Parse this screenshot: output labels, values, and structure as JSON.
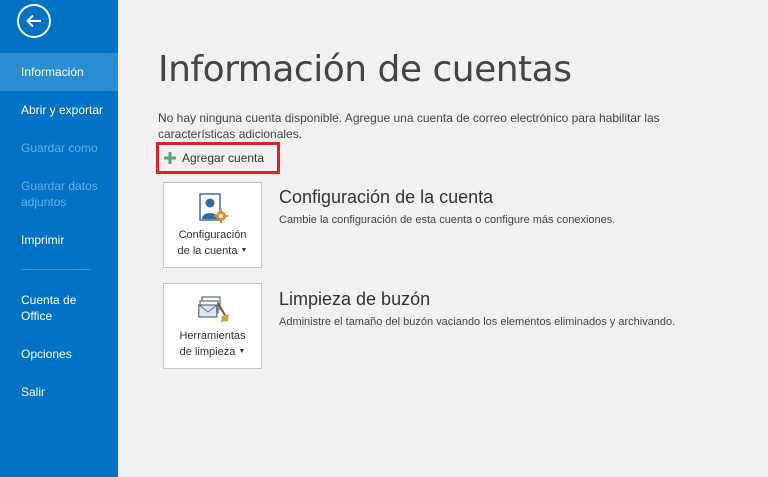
{
  "colors": {
    "sidebar": "#0072c6",
    "active_item": "#2a8dd4",
    "highlight": "#d9222a",
    "plus": "#5a9e8b"
  },
  "sidebar": {
    "back_icon": "back-arrow-icon",
    "items": [
      {
        "label": "Información",
        "state": "active"
      },
      {
        "label": "Abrir y exportar",
        "state": "enabled"
      },
      {
        "label": "Guardar como",
        "state": "disabled"
      },
      {
        "label": "Guardar datos adjuntos",
        "state": "disabled"
      },
      {
        "label": "Imprimir",
        "state": "enabled"
      },
      {
        "label": "Cuenta de Office",
        "state": "enabled"
      },
      {
        "label": "Opciones",
        "state": "enabled"
      },
      {
        "label": "Salir",
        "state": "enabled"
      }
    ]
  },
  "main": {
    "title": "Información de cuentas",
    "notice": "No hay ninguna cuenta disponible. Agregue una cuenta de correo electrónico para habilitar las características adicionales.",
    "add_account_label": "Agregar cuenta",
    "sections": [
      {
        "tile_label_line1": "Configuración",
        "tile_label_line2": "de la cuenta",
        "title": "Configuración de la cuenta",
        "description": "Cambie la configuración de esta cuenta o configure más conexiones."
      },
      {
        "tile_label_line1": "Herramientas",
        "tile_label_line2": "de limpieza",
        "title": "Limpieza de buzón",
        "description": "Administre el tamaño del buzón vaciando los elementos eliminados y archivando."
      }
    ]
  }
}
